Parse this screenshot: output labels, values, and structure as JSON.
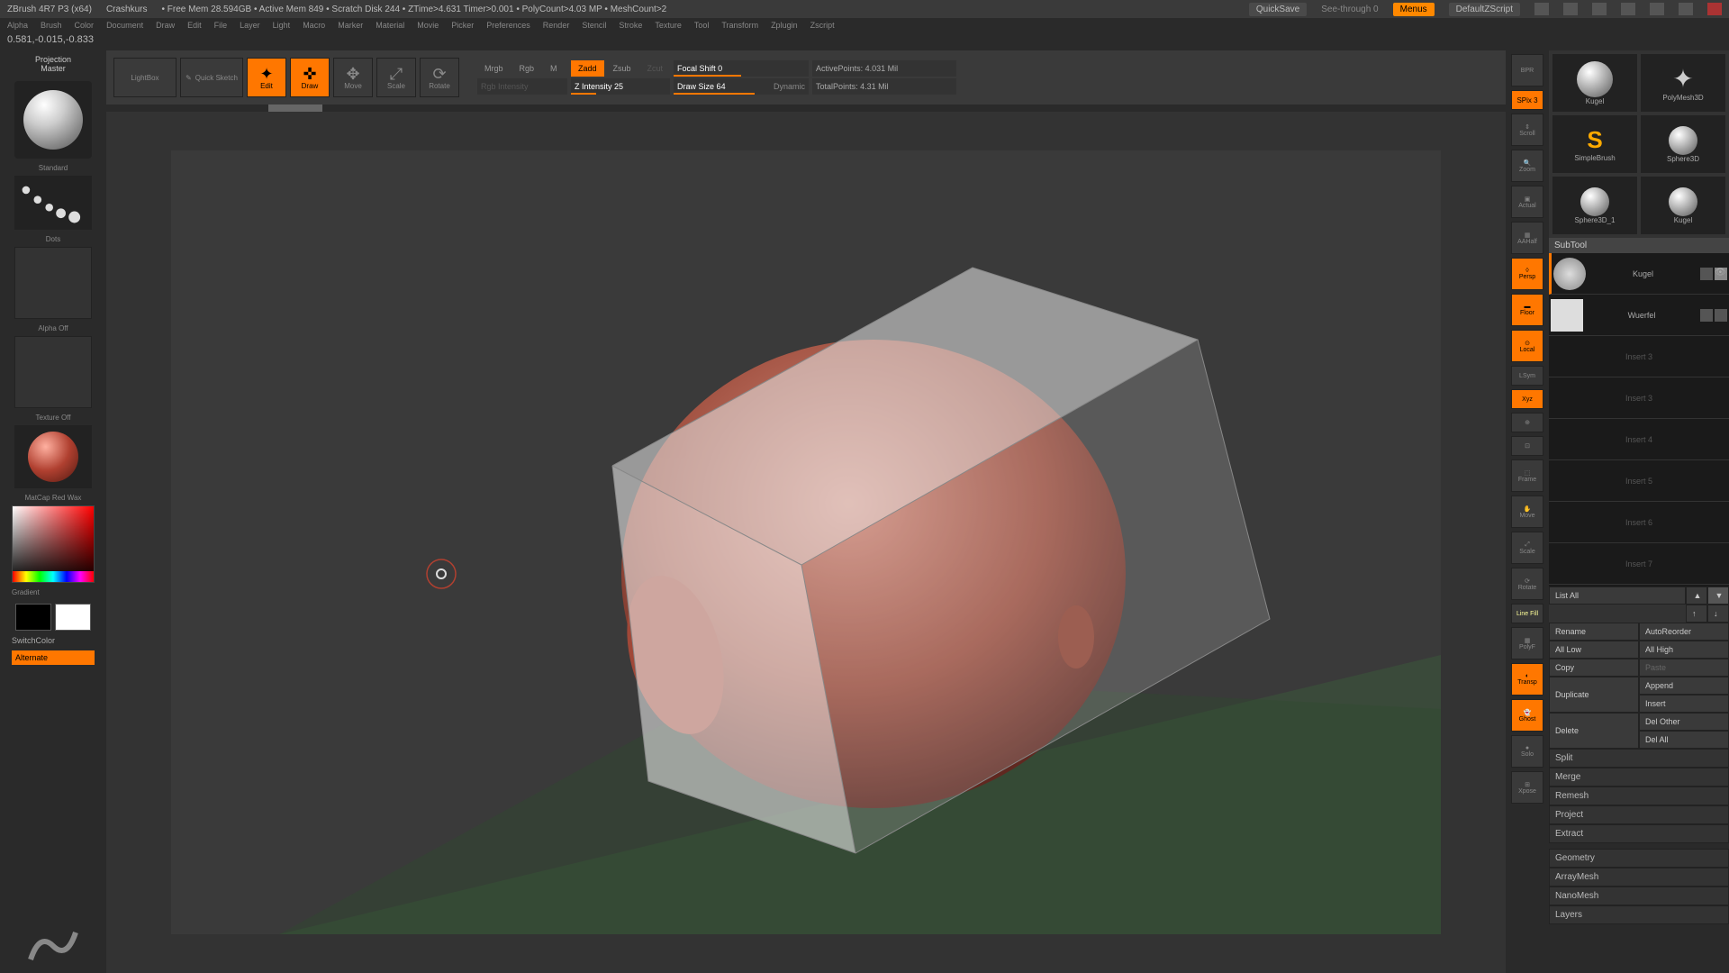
{
  "title": {
    "app": "ZBrush 4R7 P3 (x64)",
    "doc": "Crashkurs",
    "stats": "• Free Mem 28.594GB • Active Mem 849 • Scratch Disk 244 • ZTime>4.631 Timer>0.001 • PolyCount>4.03 MP • MeshCount>2",
    "quicksave": "QuickSave",
    "seethrough": "See-through  0",
    "menus": "Menus",
    "default": "DefaultZScript"
  },
  "menu": [
    "Alpha",
    "Brush",
    "Color",
    "Document",
    "Draw",
    "Edit",
    "File",
    "Layer",
    "Light",
    "Macro",
    "Marker",
    "Material",
    "Movie",
    "Picker",
    "Preferences",
    "Render",
    "Stencil",
    "Stroke",
    "Texture",
    "Tool",
    "Transform",
    "Zplugin",
    "Zscript"
  ],
  "coords": "0.581,-0.015,-0.833",
  "topbtns": {
    "projection": "Projection Master",
    "lightbox": "LightBox",
    "quicksketch": "Quick Sketch",
    "edit": "Edit",
    "draw": "Draw",
    "move": "Move",
    "scale": "Scale",
    "rotate": "Rotate"
  },
  "modes": {
    "mrgb": "Mrgb",
    "rgb": "Rgb",
    "m": "M",
    "rgbint": "Rgb Intensity",
    "zadd": "Zadd",
    "zsub": "Zsub",
    "zcut": "Zcut",
    "zint": "Z Intensity 25",
    "focal": "Focal Shift 0",
    "drawsize": "Draw Size 64",
    "dynamic": "Dynamic",
    "active": "ActivePoints: 4.031 Mil",
    "total": "TotalPoints: 4.31 Mil"
  },
  "left": {
    "brush": "Standard",
    "stroke": "Dots",
    "alpha": "Alpha Off",
    "texture": "Texture Off",
    "material": "MatCap Red Wax",
    "gradient": "Gradient",
    "switch": "SwitchColor",
    "alternate": "Alternate"
  },
  "right_tools": {
    "spix": "SPix 3",
    "bpr": "BPR",
    "scroll": "Scroll",
    "zoom": "Zoom",
    "actual": "Actual",
    "aahalf": "AAHalf",
    "persp": "Persp",
    "floor": "Floor",
    "local": "Local",
    "lsym": "LSym",
    "xyz": "Xyz",
    "frame": "Frame",
    "move": "Move",
    "scale": "Scale",
    "rotate": "Rotate",
    "linefill": "Line Fill",
    "polyf": "PolyF",
    "transp": "Transp",
    "ghost": "Ghost",
    "solo": "Solo",
    "xpose": "Xpose"
  },
  "tools": {
    "items": [
      "Kugel",
      "PolyMesh3D",
      "SimpleBrush",
      "Sphere3D",
      "Sphere3D_1",
      "Kugel"
    ]
  },
  "subtool": {
    "header": "SubTool",
    "items": [
      {
        "name": "Kugel",
        "active": true
      },
      {
        "name": "Wuerfel",
        "active": false
      },
      {
        "name": "Insert 3",
        "dim": true
      },
      {
        "name": "Insert 3",
        "dim": true
      },
      {
        "name": "Insert 4",
        "dim": true
      },
      {
        "name": "Insert 5",
        "dim": true
      },
      {
        "name": "Insert 6",
        "dim": true
      },
      {
        "name": "Insert 7",
        "dim": true
      }
    ],
    "listall": "List All"
  },
  "actions": {
    "rename": "Rename",
    "autoreorder": "AutoReorder",
    "alllow": "All Low",
    "allhigh": "All High",
    "copy": "Copy",
    "paste": "Paste",
    "duplicate": "Duplicate",
    "append": "Append",
    "insert": "Insert",
    "delete": "Delete",
    "delother": "Del Other",
    "delall": "Del All",
    "split": "Split",
    "merge": "Merge",
    "remesh": "Remesh",
    "project": "Project",
    "extract": "Extract"
  },
  "sections": [
    "Geometry",
    "ArrayMesh",
    "NanoMesh",
    "Layers"
  ]
}
